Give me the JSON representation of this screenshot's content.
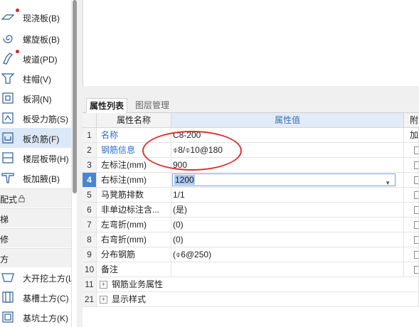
{
  "nav": {
    "items": [
      {
        "label": "现浇板(B)",
        "icon": "cast-slab-icon",
        "dot": true
      },
      {
        "label": "螺旋板(B)",
        "icon": "spiral-slab-icon",
        "dot": false
      },
      {
        "label": "坡道(PD)",
        "icon": "ramp-icon",
        "dot": true
      },
      {
        "label": "柱帽(V)",
        "icon": "column-cap-icon",
        "dot": false
      },
      {
        "label": "板洞(N)",
        "icon": "slab-hole-icon",
        "dot": false
      },
      {
        "label": "板受力筋(S)",
        "icon": "slab-stress-rebar-icon",
        "dot": false
      },
      {
        "label": "板负筋(F)",
        "icon": "slab-negative-rebar-icon",
        "dot": false,
        "active": true
      },
      {
        "label": "楼层板带(H)",
        "icon": "floor-slab-strip-icon",
        "dot": false
      },
      {
        "label": "板加腋(B)",
        "icon": "slab-haunch-icon",
        "dot": false
      }
    ],
    "sections": [
      "配式",
      "梯",
      "修",
      "方"
    ],
    "section_lock_icon": "lock-icon",
    "items2": [
      {
        "label": "大开挖土方(L",
        "icon": "excavation-icon"
      },
      {
        "label": "基槽土方(C)",
        "icon": "trench-icon"
      },
      {
        "label": "基坑土方(K)",
        "icon": "pit-icon"
      }
    ]
  },
  "tabs": {
    "properties": "属性列表",
    "layers": "图层管理"
  },
  "grid": {
    "header": {
      "name": "属性名称",
      "value": "属性值",
      "attach": "附加"
    },
    "rows": [
      {
        "num": "1",
        "name": "名称",
        "value": "C8-200",
        "link": true,
        "check": false
      },
      {
        "num": "2",
        "name": "钢筋信息",
        "value": "⌽8/⌽10@180",
        "link": true,
        "check": true
      },
      {
        "num": "3",
        "name": "左标注(mm)",
        "value": "900",
        "link": false,
        "check": true
      },
      {
        "num": "4",
        "name": "右标注(mm)",
        "value": "1200",
        "link": false,
        "check": true,
        "selected": true
      },
      {
        "num": "5",
        "name": "马凳筋排数",
        "value": "1/1",
        "link": false,
        "check": true
      },
      {
        "num": "6",
        "name": "非单边标注含...",
        "value": "(是)",
        "link": false,
        "check": true
      },
      {
        "num": "7",
        "name": "左弯折(mm)",
        "value": "(0)",
        "link": false,
        "check": true
      },
      {
        "num": "8",
        "name": "右弯折(mm)",
        "value": "(0)",
        "link": false,
        "check": true
      },
      {
        "num": "9",
        "name": "分布钢筋",
        "value": "(⌽6@250)",
        "link": false,
        "check": true
      },
      {
        "num": "10",
        "name": "备注",
        "value": "",
        "link": false,
        "check": true
      },
      {
        "num": "11",
        "name": "钢筋业务属性",
        "value": "",
        "link": false,
        "check": false,
        "group": true
      },
      {
        "num": "21",
        "name": "显示样式",
        "value": "",
        "link": false,
        "check": false,
        "group": true
      }
    ],
    "selected_dropdown_icon": "chevron-down-icon",
    "expand_icon": "plus-icon"
  },
  "colors": {
    "link": "#2a6fcf",
    "selected_row": "#4a86d0",
    "annotation": "#e0312f",
    "active_nav": "#dbe8f7"
  }
}
